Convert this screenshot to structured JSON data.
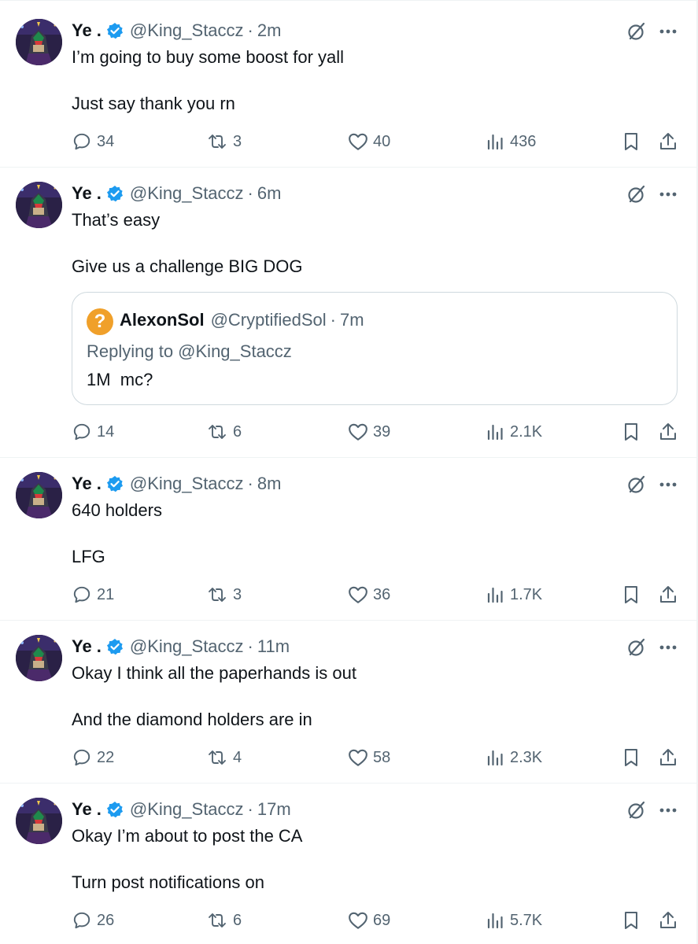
{
  "tweets": [
    {
      "name": "Ye .",
      "handle": "@King_Staccz",
      "sep": "·",
      "time": "2m",
      "line1": "I’m going to buy some boost for yall",
      "line2": "Just say thank you rn",
      "replies": "34",
      "reposts": "3",
      "likes": "40",
      "views": "436"
    },
    {
      "name": "Ye .",
      "handle": "@King_Staccz",
      "sep": "·",
      "time": "6m",
      "line1": "That’s easy",
      "line2": "Give us a challenge BIG DOG",
      "replies": "14",
      "reposts": "6",
      "likes": "39",
      "views": "2.1K",
      "quote": {
        "avatar_glyph": "?",
        "name": "AlexonSol",
        "handle": "@CryptifiedSol",
        "sep": "·",
        "time": "7m",
        "replying": "Replying to @King_Staccz",
        "text": "1M  mc?"
      }
    },
    {
      "name": "Ye .",
      "handle": "@King_Staccz",
      "sep": "·",
      "time": "8m",
      "line1": "640 holders",
      "line2": "LFG",
      "replies": "21",
      "reposts": "3",
      "likes": "36",
      "views": "1.7K"
    },
    {
      "name": "Ye .",
      "handle": "@King_Staccz",
      "sep": "·",
      "time": "11m",
      "line1": "Okay I think all the paperhands is out",
      "line2": "And the diamond holders are in",
      "replies": "22",
      "reposts": "4",
      "likes": "58",
      "views": "2.3K"
    },
    {
      "name": "Ye .",
      "handle": "@King_Staccz",
      "sep": "·",
      "time": "17m",
      "line1": "Okay I’m about to post the CA",
      "line2": "Turn post notifications on",
      "replies": "26",
      "reposts": "6",
      "likes": "69",
      "views": "5.7K"
    }
  ],
  "icons": {
    "verified": "verified-badge-icon",
    "grok": "grok-icon",
    "more": "more-icon",
    "reply": "reply-icon",
    "repost": "repost-icon",
    "like": "heart-icon",
    "views": "views-icon",
    "bookmark": "bookmark-icon",
    "share": "share-icon"
  },
  "colors": {
    "text": "#0f1419",
    "secondary": "#536471",
    "verified": "#1d9bf0",
    "border": "#eff3f4",
    "quote_avatar": "#f0a02a"
  }
}
